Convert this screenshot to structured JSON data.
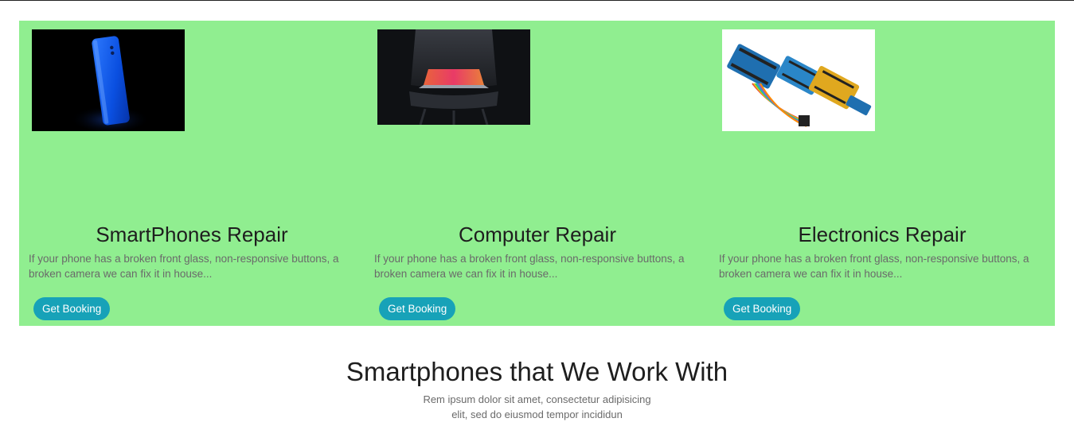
{
  "services": {
    "background": "#90ee90",
    "button_color": "#17a2b8",
    "cards": [
      {
        "image": "blue-smartphone-photo",
        "title": "SmartPhones Repair",
        "description": "If your phone has a broken front glass, non-responsive buttons, a broken camera we can fix it in house...",
        "button_label": "Get Booking"
      },
      {
        "image": "laptop-on-chair-photo",
        "title": "Computer Repair",
        "description": "If your phone has a broken front glass, non-responsive buttons, a broken camera we can fix it in house...",
        "button_label": "Get Booking"
      },
      {
        "image": "arduino-boards-photo",
        "title": "Electronics Repair",
        "description": "If your phone has a broken front glass, non-responsive buttons, a broken camera we can fix it in house...",
        "button_label": "Get Booking"
      }
    ]
  },
  "brands_section": {
    "title": "Smartphones that We Work With",
    "subtitle_line1": "Rem ipsum dolor sit amet, consectetur adipisicing",
    "subtitle_line2": "elit, sed do eiusmod tempor incididun"
  }
}
